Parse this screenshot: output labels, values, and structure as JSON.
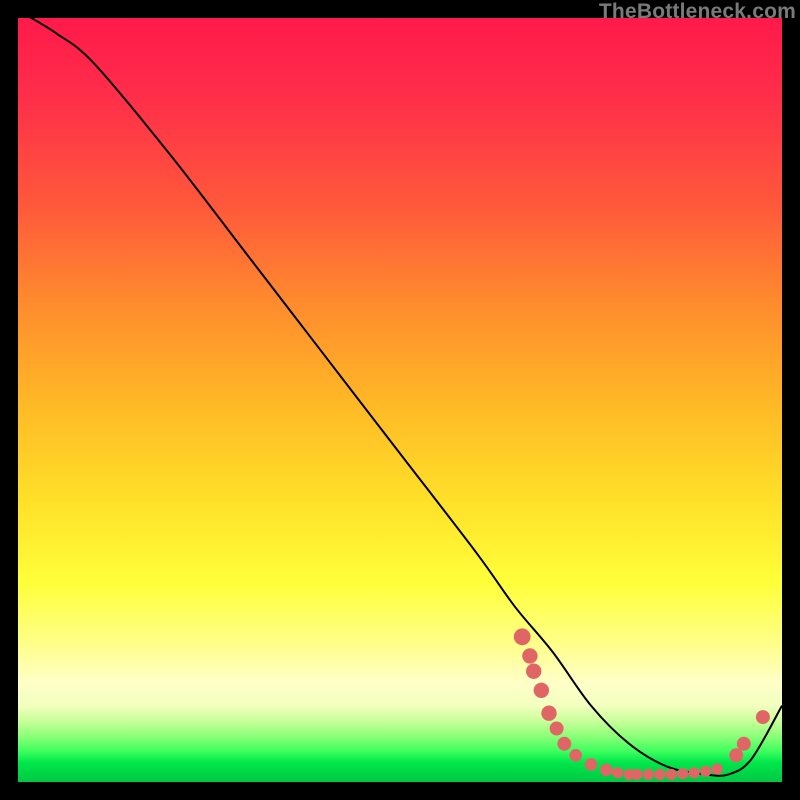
{
  "watermark": "TheBottleneck.com",
  "chart_data": {
    "type": "line",
    "title": "",
    "xlabel": "",
    "ylabel": "",
    "xlim": [
      0,
      100
    ],
    "ylim": [
      0,
      100
    ],
    "series": [
      {
        "name": "bottleneck-curve",
        "x": [
          0,
          5,
          10,
          20,
          30,
          40,
          50,
          60,
          65,
          70,
          75,
          80,
          85,
          90,
          93,
          96,
          100
        ],
        "y": [
          101,
          98,
          94,
          82,
          69,
          56,
          43,
          30,
          23,
          17,
          10,
          5,
          2,
          1,
          1,
          3,
          10
        ]
      }
    ],
    "markers": [
      {
        "x": 66.0,
        "y": 19.0,
        "r": 1.2
      },
      {
        "x": 67.0,
        "y": 16.5,
        "r": 1.1
      },
      {
        "x": 67.5,
        "y": 14.5,
        "r": 1.1
      },
      {
        "x": 68.5,
        "y": 12.0,
        "r": 1.1
      },
      {
        "x": 69.5,
        "y": 9.0,
        "r": 1.1
      },
      {
        "x": 70.5,
        "y": 7.0,
        "r": 1.0
      },
      {
        "x": 71.5,
        "y": 5.0,
        "r": 1.0
      },
      {
        "x": 73.0,
        "y": 3.5,
        "r": 0.9
      },
      {
        "x": 75.0,
        "y": 2.3,
        "r": 0.9
      },
      {
        "x": 77.0,
        "y": 1.6,
        "r": 0.9
      },
      {
        "x": 78.5,
        "y": 1.2,
        "r": 0.8
      },
      {
        "x": 80.0,
        "y": 1.0,
        "r": 0.8
      },
      {
        "x": 81.0,
        "y": 1.0,
        "r": 0.8
      },
      {
        "x": 82.5,
        "y": 1.0,
        "r": 0.8
      },
      {
        "x": 84.0,
        "y": 1.0,
        "r": 0.8
      },
      {
        "x": 85.5,
        "y": 1.0,
        "r": 0.8
      },
      {
        "x": 87.0,
        "y": 1.1,
        "r": 0.8
      },
      {
        "x": 88.5,
        "y": 1.2,
        "r": 0.8
      },
      {
        "x": 90.0,
        "y": 1.4,
        "r": 0.8
      },
      {
        "x": 91.5,
        "y": 1.7,
        "r": 0.8
      },
      {
        "x": 94.0,
        "y": 3.5,
        "r": 1.0
      },
      {
        "x": 95.0,
        "y": 5.0,
        "r": 1.0
      },
      {
        "x": 97.5,
        "y": 8.5,
        "r": 1.0
      }
    ],
    "marker_color": "#e06666",
    "line_color": "#000000"
  }
}
